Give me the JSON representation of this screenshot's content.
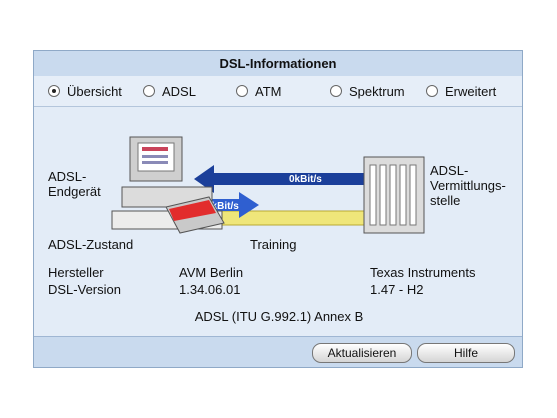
{
  "window": {
    "title": "DSL-Informationen"
  },
  "tabs": [
    {
      "label": "Übersicht",
      "checked": true
    },
    {
      "label": "ADSL",
      "checked": false
    },
    {
      "label": "ATM",
      "checked": false
    },
    {
      "label": "Spektrum",
      "checked": false
    },
    {
      "label": "Erweitert",
      "checked": false
    }
  ],
  "diagram": {
    "endpoint_label": "ADSL-\nEndgerät",
    "exchange_label": "ADSL-\nVermittlungs-\nstelle",
    "downstream": "0kBit/s",
    "upstream": "0kBit/s"
  },
  "status": {
    "zustand_label": "ADSL-Zustand",
    "zustand_value": "Training",
    "hersteller_label": "Hersteller",
    "hersteller_local": "AVM Berlin",
    "hersteller_remote": "Texas Instruments",
    "version_label": "DSL-Version",
    "version_local": "1.34.06.01",
    "version_remote": "1.47 - H2",
    "standard": "ADSL (ITU G.992.1) Annex B"
  },
  "buttons": {
    "refresh": "Aktualisieren",
    "help": "Hilfe"
  },
  "colors": {
    "arrow": "#1b3f9a",
    "line": "#e7dc55"
  }
}
